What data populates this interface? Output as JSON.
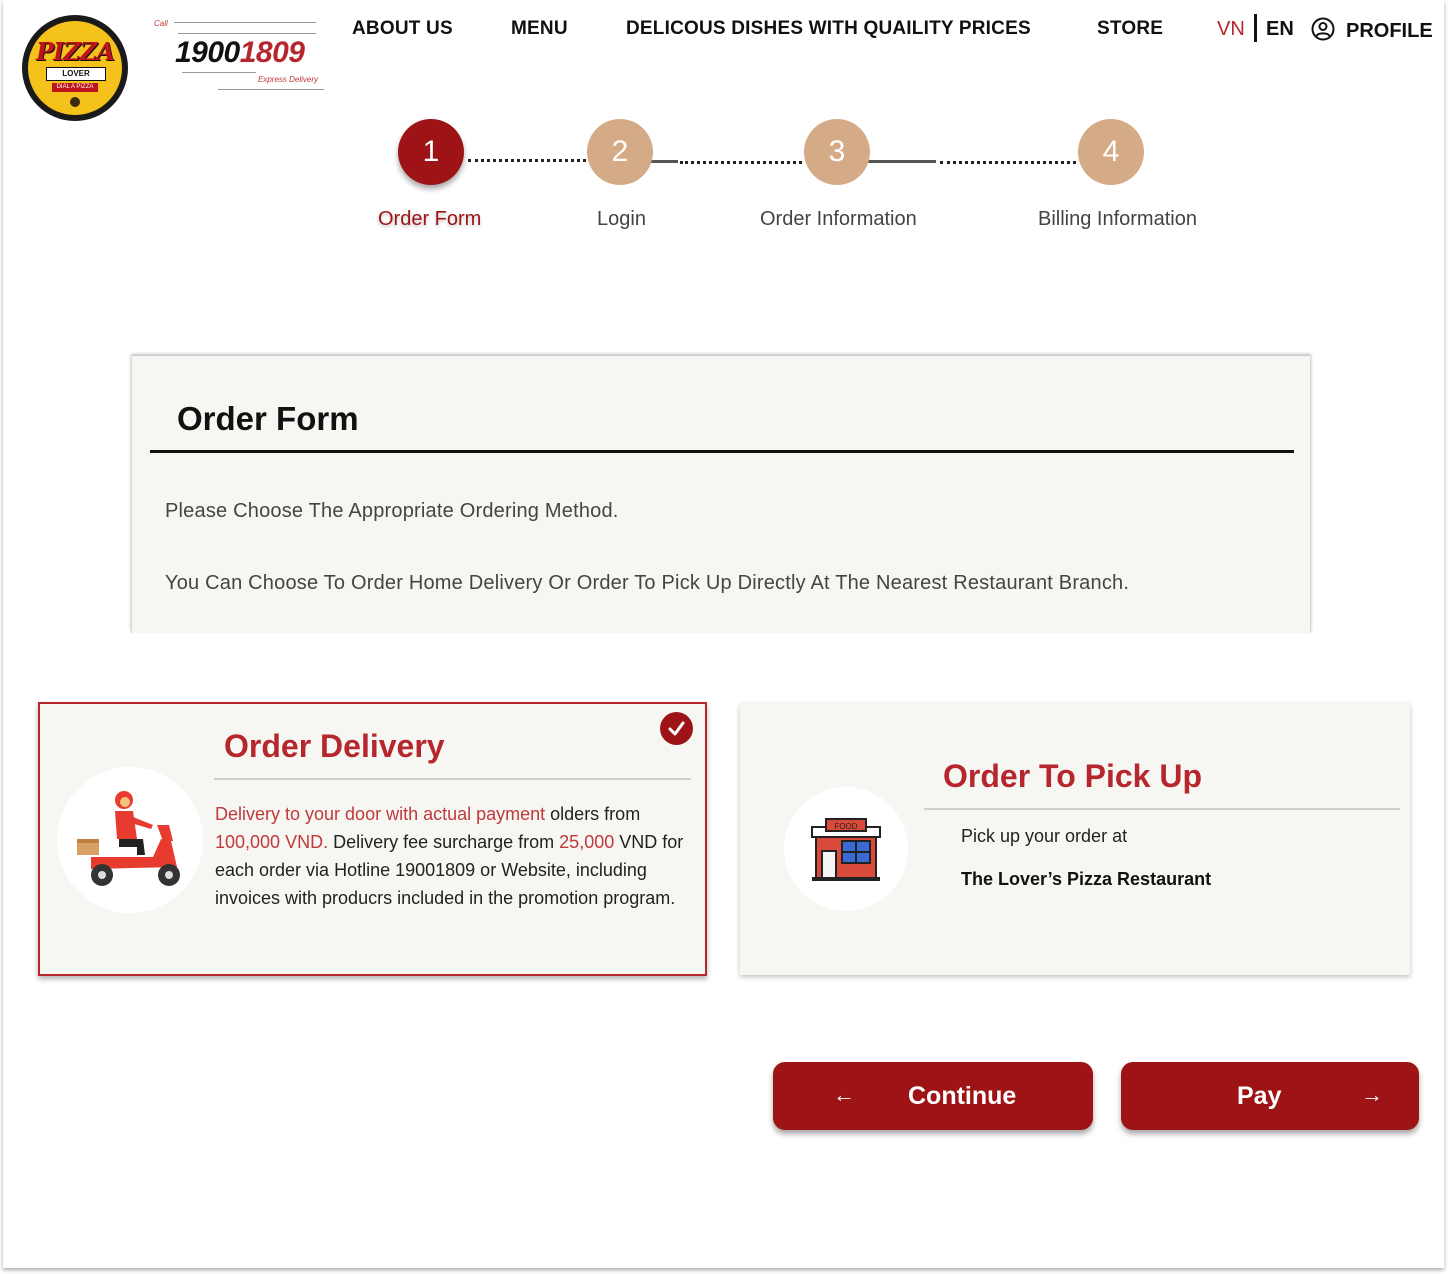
{
  "header": {
    "logo": {
      "word": "PIZZA",
      "lover": "LOVER",
      "dial": "DIAL A PIZZA"
    },
    "hotline": {
      "call": "Call",
      "number_a": "1900",
      "number_b": "1809",
      "tagline": "Express Delivery"
    },
    "nav": [
      "ABOUT US",
      "MENU",
      "DELICOUS DISHES WITH QUAILITY PRICES",
      "STORE"
    ],
    "lang": {
      "vn": "VN",
      "en": "EN"
    },
    "profile": "PROFILE"
  },
  "stepper": {
    "steps": [
      {
        "number": "1",
        "label": "Order Form",
        "active": true
      },
      {
        "number": "2",
        "label": "Login",
        "active": false
      },
      {
        "number": "3",
        "label": "Order Information",
        "active": false
      },
      {
        "number": "4",
        "label": "Billing Information",
        "active": false
      }
    ]
  },
  "order_form": {
    "title": "Order Form",
    "line1": "Please Choose The Appropriate Ordering Method.",
    "line2": "You Can Choose To Order Home Delivery Or Order To Pick Up Directly At The Nearest Restaurant Branch."
  },
  "delivery": {
    "title": "Order Delivery",
    "selected": true,
    "desc": {
      "a": "Delivery to your door with actual payment",
      "b": " olders from ",
      "c": "100,000 VND.",
      "d": " Delivery fee surcharge from ",
      "e": "25,000",
      "f": " VND for each order via Hotline 19001809 or Website, including invoices with producrs included in the promotion program."
    }
  },
  "pickup": {
    "title": "Order To Pick Up",
    "line1": "Pick up your order at",
    "line2": "The Lover’s Pizza Restaurant",
    "sign": "FOOD"
  },
  "buttons": {
    "continue": {
      "label": "Continue",
      "arrow": "←"
    },
    "pay": {
      "label": "Pay",
      "arrow": "→"
    }
  },
  "colors": {
    "brand_red": "#9e1315",
    "accent_red": "#b5272d",
    "step_idle": "#d5aa86",
    "panel_bg": "#f6f6f2"
  }
}
